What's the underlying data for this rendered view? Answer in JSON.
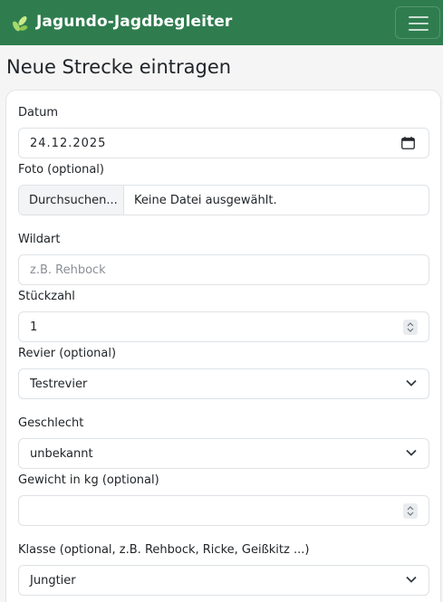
{
  "navbar": {
    "brand": "Jagundo-Jagdbegleiter",
    "brand_icon": "leaf-icon",
    "menu_icon": "hamburger-menu-icon",
    "brand_color": "#2f7d4f"
  },
  "page": {
    "title": "Neue Strecke eintragen"
  },
  "form": {
    "date": {
      "label": "Datum",
      "value": "24.12.2025",
      "icon": "calendar-icon"
    },
    "photo": {
      "label": "Foto (optional)",
      "button": "Durchsuchen...",
      "status": "Keine Datei ausgewählt."
    },
    "species": {
      "label": "Wildart",
      "placeholder": "z.B. Rehbock",
      "value": ""
    },
    "count": {
      "label": "Stückzahl",
      "value": "1"
    },
    "territory": {
      "label": "Revier (optional)",
      "selected": "Testrevier"
    },
    "sex": {
      "label": "Geschlecht",
      "selected": "unbekannt"
    },
    "weight": {
      "label": "Gewicht in kg (optional)",
      "value": ""
    },
    "class": {
      "label": "Klasse (optional, z.B. Rehbock, Ricke, Geißkitz ...)",
      "selected": "Jungtier"
    }
  }
}
